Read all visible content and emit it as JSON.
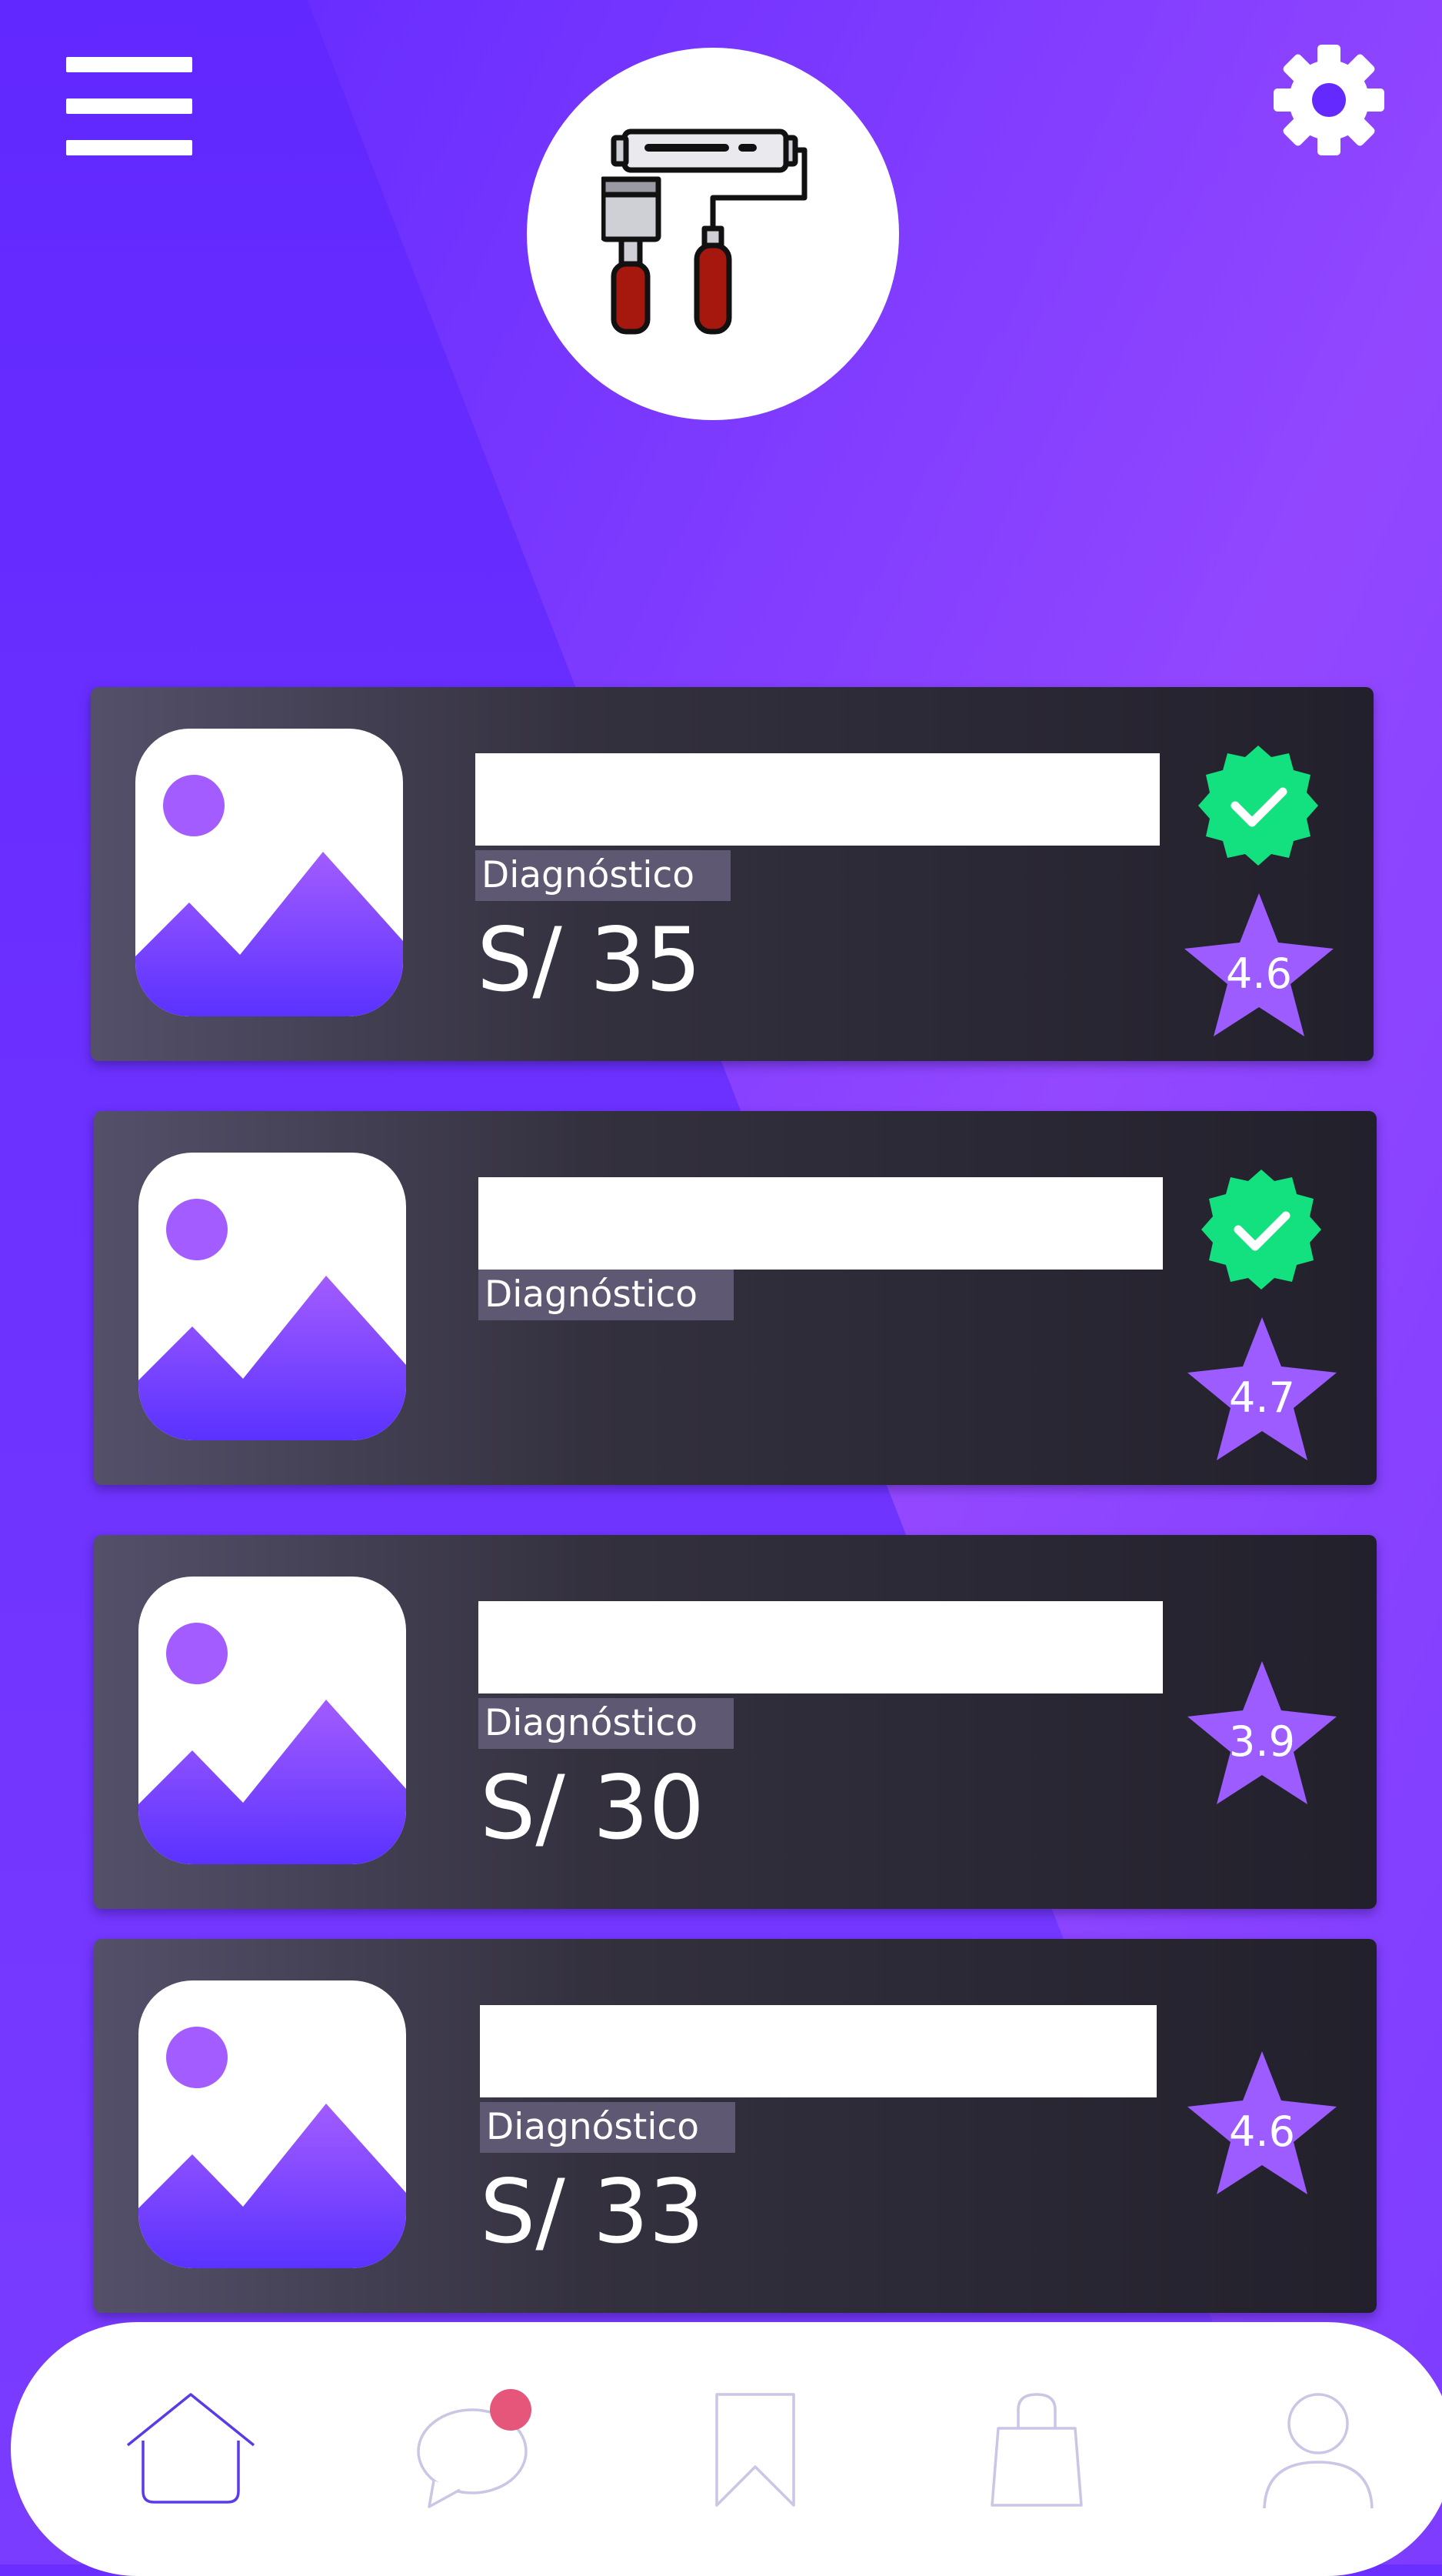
{
  "header": {
    "menu_icon": "hamburger-menu-icon",
    "settings_icon": "gear-icon",
    "logo_icon": "paint-roller-and-brush-icon"
  },
  "colors": {
    "background": "#6a2eff",
    "card": "#2a2833",
    "accent": "#9d5cff",
    "verified": "#13e07f",
    "notification": "#e6567a",
    "nav_active": "#5b3ae8",
    "nav_inactive": "#c9c6e6"
  },
  "listings": [
    {
      "tag": "Diagnóstico",
      "price": "S/ 35",
      "rating": "4.6",
      "verified": true
    },
    {
      "tag": "Diagnóstico",
      "price": "",
      "rating": "4.7",
      "verified": true
    },
    {
      "tag": "Diagnóstico",
      "price": "S/ 30",
      "rating": "3.9",
      "verified": false
    },
    {
      "tag": "Diagnóstico",
      "price": "S/ 33",
      "rating": "4.6",
      "verified": false
    }
  ],
  "bottom_nav": {
    "items": [
      {
        "icon": "home-icon",
        "active": true
      },
      {
        "icon": "chat-bubble-icon",
        "active": false,
        "has_notification": true
      },
      {
        "icon": "bookmark-icon",
        "active": false
      },
      {
        "icon": "shopping-bag-icon",
        "active": false
      },
      {
        "icon": "user-profile-icon",
        "active": false
      }
    ]
  }
}
